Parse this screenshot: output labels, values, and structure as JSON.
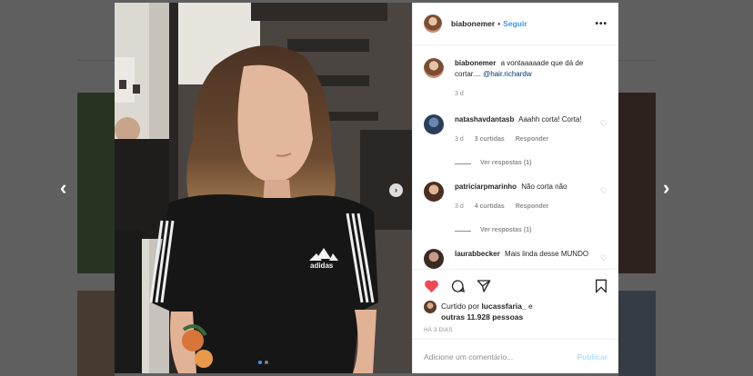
{
  "header": {
    "username": "biabonemer",
    "separator": "•",
    "follow_label": "Seguir",
    "more_label": "•••"
  },
  "caption": {
    "username": "biabonemer",
    "text": "a vontaaaaade que dá de cortar....",
    "mention": "@hair.richardw",
    "time": "3 d"
  },
  "comments": [
    {
      "username": "natashavdantasb",
      "text": "Aaahh corta! Corta!",
      "time": "3 d",
      "likes": "3 curtidas",
      "reply_label": "Responder",
      "view_replies": "Ver respostas (1)"
    },
    {
      "username": "patriciarpmarinho",
      "text": "Não corta não",
      "time": "3 d",
      "likes": "4 curtidas",
      "reply_label": "Responder",
      "view_replies": "Ver respostas (1)"
    },
    {
      "username": "laurabbecker",
      "text": "Mais linda desse MUNDO"
    }
  ],
  "likes": {
    "prefix": "Curtido por",
    "user": "lucassfaria_",
    "suffix": "e",
    "others": "outras 11.928 pessoas"
  },
  "post_age": "HÁ 3 DIAS",
  "add_comment": {
    "placeholder": "Adicione um comentário...",
    "publish_label": "Publicar"
  },
  "photo": {
    "shirt_logo": "adidas",
    "carousel_next_label": "›",
    "slide_count": 2,
    "current_slide": 1
  },
  "nav": {
    "prev_label": "‹",
    "next_label": "›"
  },
  "colors": {
    "accent": "#3897f0",
    "like": "#ed4956",
    "publish_disabled": "#b2dffc"
  },
  "icons": [
    "heart-filled-icon",
    "comment-icon",
    "share-icon",
    "save-icon",
    "heart-outline-icon",
    "more-options-icon"
  ]
}
